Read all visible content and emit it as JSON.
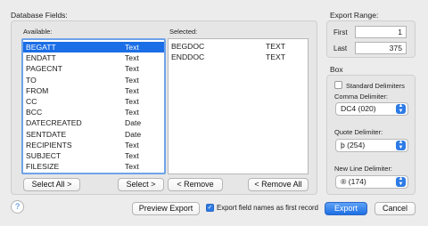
{
  "database_fields": {
    "title": "Database Fields:",
    "available_label": "Available:",
    "selected_label": "Selected:",
    "available": [
      {
        "name": "BEGATT",
        "type": "Text"
      },
      {
        "name": "ENDATT",
        "type": "Text"
      },
      {
        "name": "PAGECNT",
        "type": "Text"
      },
      {
        "name": "TO",
        "type": "Text"
      },
      {
        "name": "FROM",
        "type": "Text"
      },
      {
        "name": "CC",
        "type": "Text"
      },
      {
        "name": "BCC",
        "type": "Text"
      },
      {
        "name": "DATECREATED",
        "type": "Date"
      },
      {
        "name": "SENTDATE",
        "type": "Date"
      },
      {
        "name": "RECIPIENTS",
        "type": "Text"
      },
      {
        "name": "SUBJECT",
        "type": "Text"
      },
      {
        "name": "FILESIZE",
        "type": "Text"
      }
    ],
    "available_selected_index": 0,
    "selected": [
      {
        "name": "BEGDOC",
        "type": "TEXT"
      },
      {
        "name": "ENDDOC",
        "type": "TEXT"
      }
    ],
    "buttons": {
      "select_all": "Select All >",
      "select": "Select >",
      "remove": "< Remove",
      "remove_all": "< Remove All"
    }
  },
  "export_range": {
    "title": "Export Range:",
    "first_label": "First",
    "first_value": "1",
    "last_label": "Last",
    "last_value": "375"
  },
  "box": {
    "title": "Box",
    "standard_delimiters_label": "Standard Delimiters",
    "standard_delimiters_checked": false,
    "comma_label": "Comma Delimiter:",
    "comma_value": "DC4 (020)",
    "quote_label": "Quote Delimiter:",
    "quote_value": "þ (254)",
    "newline_label": "New Line Delimiter:",
    "newline_value": "® (174)"
  },
  "footer": {
    "help": "?",
    "preview_export": "Preview Export",
    "export_field_names_label": "Export field names as first record",
    "export_field_names_checked": true,
    "export": "Export",
    "cancel": "Cancel"
  },
  "colors": {
    "selection": "#1b6ee6",
    "accent": "#2d7be6"
  }
}
